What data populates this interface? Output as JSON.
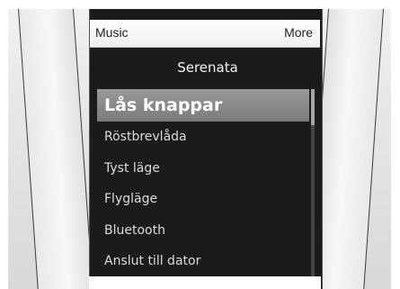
{
  "softkeys": {
    "left": "Music",
    "right": "More"
  },
  "menu": {
    "title": "Serenata",
    "items": [
      {
        "label": "Lås knappar",
        "selected": true
      },
      {
        "label": "Röstbrevlåda",
        "selected": false
      },
      {
        "label": "Tyst läge",
        "selected": false
      },
      {
        "label": "Flygläge",
        "selected": false
      },
      {
        "label": "Bluetooth",
        "selected": false
      },
      {
        "label": "Anslut till dator",
        "selected": false
      }
    ]
  },
  "colors": {
    "screen_background": "#1b1b1b",
    "selection": "#8a8a8a",
    "device_body": "#e6e6e6"
  },
  "scroll": {
    "position_fraction": 0.0
  }
}
